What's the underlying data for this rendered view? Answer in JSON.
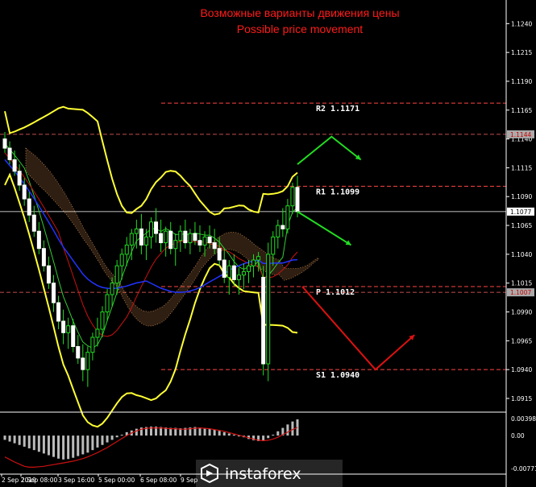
{
  "chart_data": [
    {
      "type": "candlestick",
      "title": "Возможные варианты движения цены",
      "subtitle": "Possible price movement",
      "price_axis": {
        "ticks": [
          1.124,
          1.1215,
          1.119,
          1.1165,
          1.114,
          1.1115,
          1.109,
          1.1065,
          1.104,
          1.1015,
          1.099,
          1.0965,
          1.094,
          1.0915
        ],
        "ylim": [
          1.0908,
          1.125
        ]
      },
      "time_axis": {
        "labels": [
          "2 Sep 2019",
          "2 Sep 08:00",
          "3 Sep 16:00",
          "5 Sep 00:00",
          "6 Sep 08:00",
          "9 Sep"
        ]
      },
      "markers": {
        "current_price": {
          "label": "1.1077",
          "value": 1.1077
        },
        "resistance_tag": {
          "label": "1.1144",
          "value": 1.1144
        },
        "support_tag": {
          "label": "1.1007",
          "value": 1.1007
        }
      },
      "levels": [
        {
          "name": "R2",
          "label": "R2 1.1171",
          "value": 1.1171,
          "color": "#ff4444"
        },
        {
          "name": "R1",
          "label": "R1 1.1099",
          "value": 1.1099,
          "color": "#ff4444"
        },
        {
          "name": "P",
          "label": "P 1.1012",
          "value": 1.1012,
          "color": "#ff4444"
        },
        {
          "name": "S1",
          "label": "S1 1.0940",
          "value": 1.094,
          "color": "#ff4444"
        }
      ],
      "candles": [
        {
          "o": 1.114,
          "h": 1.1146,
          "l": 1.1128,
          "c": 1.1132
        },
        {
          "o": 1.1132,
          "h": 1.1138,
          "l": 1.1118,
          "c": 1.1122
        },
        {
          "o": 1.1122,
          "h": 1.113,
          "l": 1.1108,
          "c": 1.1112
        },
        {
          "o": 1.1112,
          "h": 1.1118,
          "l": 1.1095,
          "c": 1.11
        },
        {
          "o": 1.11,
          "h": 1.1106,
          "l": 1.1082,
          "c": 1.1088
        },
        {
          "o": 1.1088,
          "h": 1.1094,
          "l": 1.1068,
          "c": 1.1074
        },
        {
          "o": 1.1074,
          "h": 1.1082,
          "l": 1.1055,
          "c": 1.106
        },
        {
          "o": 1.106,
          "h": 1.1068,
          "l": 1.104,
          "c": 1.1045
        },
        {
          "o": 1.1045,
          "h": 1.1052,
          "l": 1.1025,
          "c": 1.103
        },
        {
          "o": 1.103,
          "h": 1.1038,
          "l": 1.101,
          "c": 1.1015
        },
        {
          "o": 1.1015,
          "h": 1.1022,
          "l": 1.099,
          "c": 1.0998
        },
        {
          "o": 1.0998,
          "h": 1.1004,
          "l": 1.0975,
          "c": 1.0982
        },
        {
          "o": 1.0982,
          "h": 1.0992,
          "l": 1.0962,
          "c": 1.0972
        },
        {
          "o": 1.0972,
          "h": 1.0985,
          "l": 1.0958,
          "c": 1.0978
        },
        {
          "o": 1.0978,
          "h": 1.0984,
          "l": 1.0955,
          "c": 1.096
        },
        {
          "o": 1.096,
          "h": 1.097,
          "l": 1.0945,
          "c": 1.095
        },
        {
          "o": 1.095,
          "h": 1.0962,
          "l": 1.093,
          "c": 1.094
        },
        {
          "o": 1.094,
          "h": 1.096,
          "l": 1.0925,
          "c": 1.0955
        },
        {
          "o": 1.0955,
          "h": 1.0972,
          "l": 1.0948,
          "c": 1.0968
        },
        {
          "o": 1.0968,
          "h": 1.0985,
          "l": 1.096,
          "c": 1.0975
        },
        {
          "o": 1.0975,
          "h": 1.0995,
          "l": 1.0968,
          "c": 1.099
        },
        {
          "o": 1.099,
          "h": 1.101,
          "l": 1.0982,
          "c": 1.1005
        },
        {
          "o": 1.1005,
          "h": 1.102,
          "l": 1.0995,
          "c": 1.1015
        },
        {
          "o": 1.1015,
          "h": 1.1035,
          "l": 1.1005,
          "c": 1.103
        },
        {
          "o": 1.103,
          "h": 1.1045,
          "l": 1.1018,
          "c": 1.104
        },
        {
          "o": 1.104,
          "h": 1.1055,
          "l": 1.103,
          "c": 1.1048
        },
        {
          "o": 1.1048,
          "h": 1.1062,
          "l": 1.1035,
          "c": 1.1058
        },
        {
          "o": 1.1058,
          "h": 1.107,
          "l": 1.1045,
          "c": 1.1062
        },
        {
          "o": 1.1062,
          "h": 1.1075,
          "l": 1.104,
          "c": 1.1048
        },
        {
          "o": 1.1048,
          "h": 1.1062,
          "l": 1.1035,
          "c": 1.1055
        },
        {
          "o": 1.1055,
          "h": 1.1072,
          "l": 1.1045,
          "c": 1.1068
        },
        {
          "o": 1.1068,
          "h": 1.108,
          "l": 1.105,
          "c": 1.1058
        },
        {
          "o": 1.1058,
          "h": 1.107,
          "l": 1.1042,
          "c": 1.105
        },
        {
          "o": 1.105,
          "h": 1.1064,
          "l": 1.1038,
          "c": 1.106
        },
        {
          "o": 1.106,
          "h": 1.1068,
          "l": 1.104,
          "c": 1.1045
        },
        {
          "o": 1.1045,
          "h": 1.1058,
          "l": 1.103,
          "c": 1.1052
        },
        {
          "o": 1.1052,
          "h": 1.1065,
          "l": 1.1042,
          "c": 1.106
        },
        {
          "o": 1.106,
          "h": 1.107,
          "l": 1.1045,
          "c": 1.105
        },
        {
          "o": 1.105,
          "h": 1.1062,
          "l": 1.104,
          "c": 1.1058
        },
        {
          "o": 1.1058,
          "h": 1.1068,
          "l": 1.1048,
          "c": 1.1052
        },
        {
          "o": 1.1052,
          "h": 1.1065,
          "l": 1.1042,
          "c": 1.1048
        },
        {
          "o": 1.1048,
          "h": 1.106,
          "l": 1.1038,
          "c": 1.1055
        },
        {
          "o": 1.1055,
          "h": 1.1065,
          "l": 1.1045,
          "c": 1.105
        },
        {
          "o": 1.105,
          "h": 1.1062,
          "l": 1.104,
          "c": 1.1045
        },
        {
          "o": 1.1045,
          "h": 1.1055,
          "l": 1.103,
          "c": 1.1035
        },
        {
          "o": 1.1035,
          "h": 1.1045,
          "l": 1.1015,
          "c": 1.102
        },
        {
          "o": 1.102,
          "h": 1.1035,
          "l": 1.1005,
          "c": 1.103
        },
        {
          "o": 1.103,
          "h": 1.104,
          "l": 1.1012,
          "c": 1.1018
        },
        {
          "o": 1.1018,
          "h": 1.1028,
          "l": 1.1005,
          "c": 1.1022
        },
        {
          "o": 1.1022,
          "h": 1.1032,
          "l": 1.101,
          "c": 1.1025
        },
        {
          "o": 1.1025,
          "h": 1.1035,
          "l": 1.1015,
          "c": 1.103
        },
        {
          "o": 1.103,
          "h": 1.104,
          "l": 1.102,
          "c": 1.1035
        },
        {
          "o": 1.1035,
          "h": 1.1042,
          "l": 1.1025,
          "c": 1.1038
        },
        {
          "o": 1.102,
          "h": 1.103,
          "l": 1.0935,
          "c": 1.0945
        },
        {
          "o": 1.0945,
          "h": 1.105,
          "l": 1.093,
          "c": 1.104
        },
        {
          "o": 1.104,
          "h": 1.106,
          "l": 1.103,
          "c": 1.1055
        },
        {
          "o": 1.1055,
          "h": 1.107,
          "l": 1.1045,
          "c": 1.1065
        },
        {
          "o": 1.1065,
          "h": 1.108,
          "l": 1.1055,
          "c": 1.1062
        },
        {
          "o": 1.1062,
          "h": 1.1088,
          "l": 1.1058,
          "c": 1.1082
        },
        {
          "o": 1.1082,
          "h": 1.1102,
          "l": 1.1075,
          "c": 1.1098
        },
        {
          "o": 1.1098,
          "h": 1.1108,
          "l": 1.1072,
          "c": 1.1077
        }
      ],
      "macd": {
        "ticks": [
          "0.00398",
          "0.00",
          "-0.00771"
        ],
        "ylim": [
          -0.00771,
          0.00398
        ],
        "histogram": [
          -0.001,
          -0.0014,
          -0.0018,
          -0.0022,
          -0.0026,
          -0.003,
          -0.0034,
          -0.0038,
          -0.0042,
          -0.0046,
          -0.005,
          -0.0054,
          -0.0056,
          -0.0055,
          -0.0052,
          -0.0048,
          -0.0044,
          -0.004,
          -0.0034,
          -0.0028,
          -0.0022,
          -0.0016,
          -0.001,
          -0.0004,
          0.0002,
          0.0008,
          0.0012,
          0.0016,
          0.0019,
          0.002,
          0.0021,
          0.0021,
          0.002,
          0.0019,
          0.0018,
          0.0018,
          0.0017,
          0.0018,
          0.0019,
          0.002,
          0.0019,
          0.0018,
          0.0016,
          0.0014,
          0.0011,
          0.0008,
          0.0005,
          0.0002,
          -0.0002,
          -0.0004,
          -0.0008,
          -0.0011,
          -0.0013,
          -0.0012,
          -0.0006,
          0.0002,
          0.001,
          0.0018,
          0.0026,
          0.0033,
          0.0038
        ],
        "signal": [
          -0.005,
          -0.0056,
          -0.0062,
          -0.0067,
          -0.0072,
          -0.0074,
          -0.0074,
          -0.0073,
          -0.0072,
          -0.007,
          -0.0068,
          -0.0066,
          -0.0064,
          -0.0062,
          -0.006,
          -0.0057,
          -0.0054,
          -0.005,
          -0.0045,
          -0.004,
          -0.0034,
          -0.0028,
          -0.0021,
          -0.0014,
          -0.0007,
          0.0,
          0.0006,
          0.0011,
          0.0015,
          0.0017,
          0.0018,
          0.0018,
          0.0018,
          0.0017,
          0.0016,
          0.0016,
          0.0015,
          0.0015,
          0.0016,
          0.0017,
          0.0018,
          0.0017,
          0.0016,
          0.0014,
          0.0012,
          0.001,
          0.0007,
          0.0004,
          0.0001,
          -0.0002,
          -0.0005,
          -0.0008,
          -0.0011,
          -0.0012,
          -0.0011,
          -0.0008,
          -0.0004,
          0.0002,
          0.0008,
          0.0014,
          0.0019
        ]
      },
      "forecast_arrows": [
        {
          "color": "#22dd22",
          "points": [
            [
              60,
              1.1077
            ],
            [
              71,
              1.1048
            ]
          ]
        },
        {
          "color": "#22dd22",
          "points": [
            [
              60,
              1.1118
            ],
            [
              67,
              1.1142
            ],
            [
              73,
              1.1122
            ]
          ]
        },
        {
          "color": "#dd1111",
          "points": [
            [
              61,
              1.1012
            ],
            [
              76,
              1.094
            ],
            [
              84,
              1.097
            ]
          ]
        }
      ],
      "grid": false,
      "colors": {
        "background": "#000000",
        "bull_candle": "#22dd22",
        "bear_candle": "#ffffff",
        "bollinger": "#ffff33",
        "ma_green": "#33cc33",
        "ma_red": "#cc1111",
        "ma_blue": "#2233ff",
        "ichimoku": "#ffaa66",
        "macd_hist": "#bbbbbb",
        "macd_signal": "#cc1111",
        "tag_bg": "#aaaaaa"
      }
    }
  ],
  "branding": {
    "name": "instaforex"
  }
}
